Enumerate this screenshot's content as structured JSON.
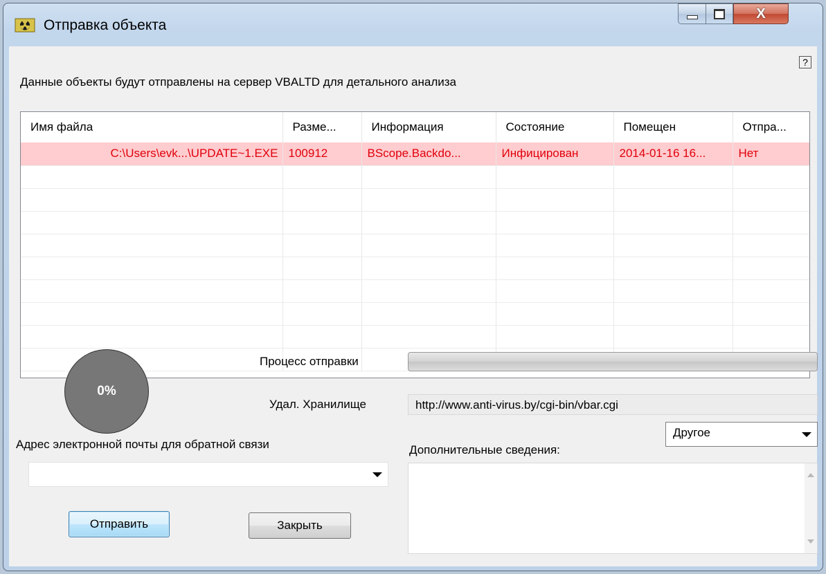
{
  "window": {
    "title": "Отправка объекта",
    "help_label": "?",
    "close_label": "X"
  },
  "intro_text": "Данные объекты будут отправлены на сервер VBALTD для детального анализа",
  "table": {
    "columns": [
      "Имя файла",
      "Разме...",
      "Информация",
      "Состояние",
      "Помещен",
      "Отпра..."
    ],
    "rows": [
      {
        "file": "C:\\Users\\evk...\\UPDATE~1.EXE",
        "size": "100912",
        "info": "BScope.Backdo...",
        "status": "Инфицирован",
        "placed": "2014-01-16 16...",
        "sent": "Нет"
      }
    ]
  },
  "progress": {
    "percent_label": "0%",
    "percent": 0,
    "process_label": "Процесс отправки",
    "storage_label": "Удал. Хранилище",
    "storage_url": "http://www.anti-virus.by/cgi-bin/vbar.cgi"
  },
  "email": {
    "label": "Адрес электронной почты для обратной связи",
    "value": ""
  },
  "details": {
    "label": "Дополнительные сведения:",
    "type_value": "Другое",
    "text": ""
  },
  "buttons": {
    "send": "Отправить",
    "close": "Закрыть"
  },
  "colors": {
    "selected_row_bg": "#ffcccf",
    "selected_row_text": "#e0000b"
  }
}
